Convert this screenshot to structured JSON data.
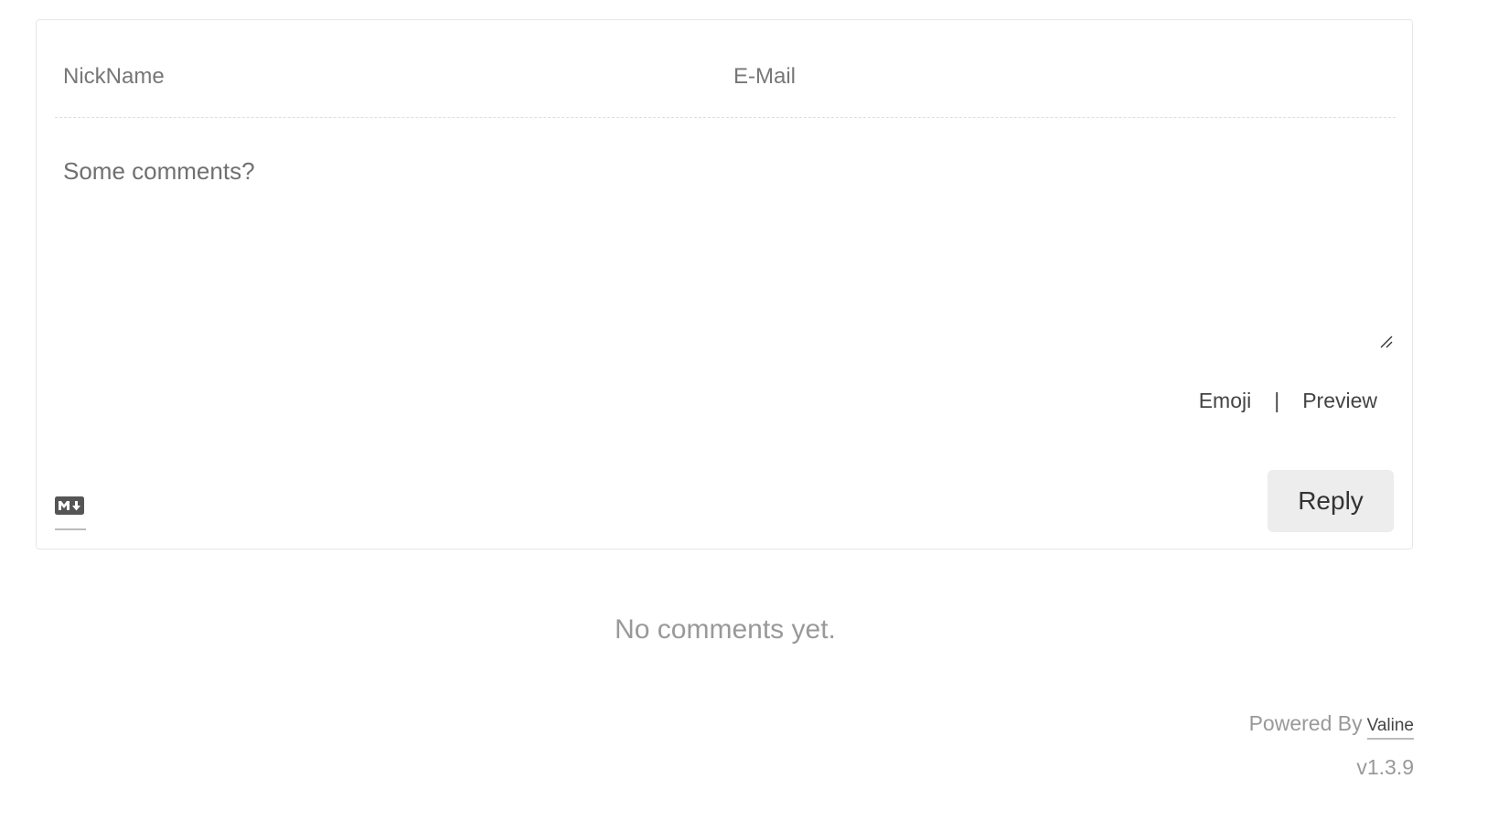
{
  "form": {
    "nickname_placeholder": "NickName",
    "email_placeholder": "E-Mail",
    "comment_placeholder": "Some comments?",
    "tools": {
      "emoji_label": "Emoji",
      "separator": "|",
      "preview_label": "Preview"
    },
    "markdown_icon": "markdown-icon",
    "reply_label": "Reply"
  },
  "comments": {
    "empty_message": "No comments yet."
  },
  "footer": {
    "powered_by_label": "Powered By",
    "brand_name": "Valine",
    "version": "v1.3.9"
  },
  "colors": {
    "panel_border": "#e6e6e6",
    "button_bg": "#ededed",
    "muted_text": "#999999"
  }
}
